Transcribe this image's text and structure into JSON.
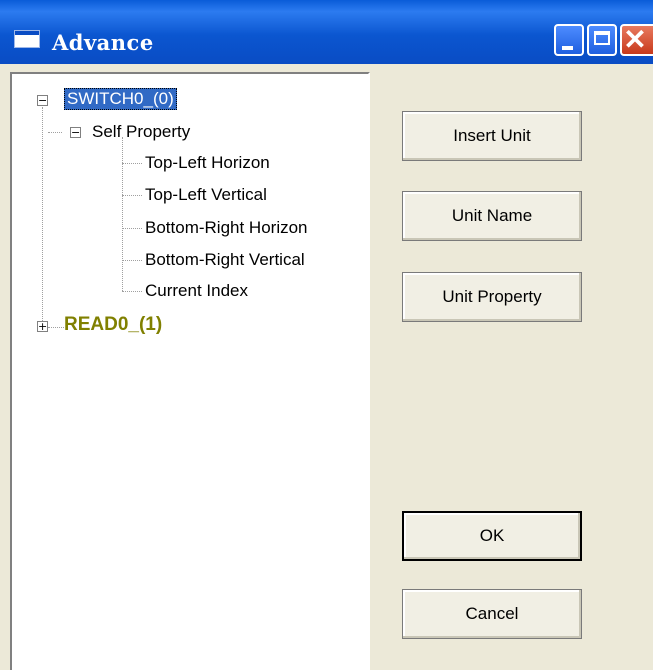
{
  "window": {
    "title": "Advance"
  },
  "tree": {
    "root1": {
      "label": "SWITCH0_(0)",
      "expanded": "−"
    },
    "self_property": {
      "label": "Self Property",
      "expanded": "−"
    },
    "children": [
      "Top-Left Horizon",
      "Top-Left Vertical",
      "Bottom-Right Horizon",
      "Bottom-Right Vertical",
      "Current Index"
    ],
    "root2": {
      "label": "READ0_(1)",
      "expanded": "+"
    }
  },
  "buttons": {
    "insert_unit": "Insert Unit",
    "unit_name": "Unit Name",
    "unit_property": "Unit Property",
    "ok": "OK",
    "cancel": "Cancel"
  },
  "colors": {
    "selection": "#316AC5",
    "olive_root": "#808000",
    "dialog_bg": "#ECE9D8"
  }
}
